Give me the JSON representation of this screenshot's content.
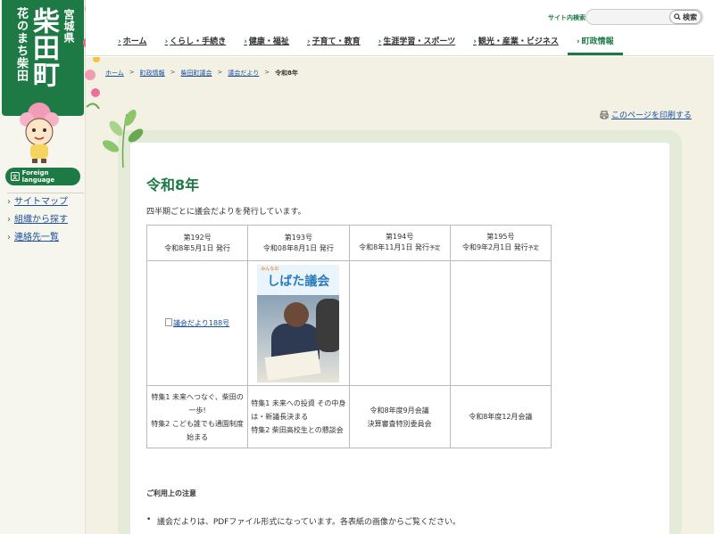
{
  "logo": {
    "sub": "花のまち柴田",
    "big": "柴田町",
    "pref": "宮城県"
  },
  "sidebar": {
    "foreign_label": "Foreign language",
    "links": [
      "サイトマップ",
      "組織から探す",
      "連絡先一覧"
    ]
  },
  "header": {
    "search_label": "サイト内検索",
    "search_placeholder": "",
    "search_button": "検索",
    "nav": [
      "ホーム",
      "くらし・手続き",
      "健康・福祉",
      "子育て・教育",
      "生涯学習・スポーツ",
      "観光・産業・ビジネス",
      "町政情報"
    ],
    "active_nav": "町政情報"
  },
  "breadcrumb": {
    "links": [
      "ホーム",
      "町政情報",
      "柴田町議会",
      "議会だより"
    ],
    "current": "令和8年"
  },
  "print_label": "このページを印刷する",
  "page": {
    "title": "令和8年",
    "intro": "四半期ごとに議会だよりを発行しています。",
    "issues": [
      {
        "number": "第192号",
        "date": "令和8年5月1日 発行",
        "pending": "",
        "image_alt": "議会だより188号",
        "desc": [
          "特集1 未来へつなぐ、柴田の一歩!",
          "特集2 こども誰でも通園制度 始まる"
        ]
      },
      {
        "number": "第193号",
        "date": "令和08年8月1日 発行",
        "pending": "",
        "image_alt": "",
        "desc": [
          "特集1 未来への投資 その中身は・新議長決まる",
          "特集2 柴田高校生との懇談会"
        ]
      },
      {
        "number": "第194号",
        "date": "令和8年11月1日 発行",
        "pending": "予定",
        "image_alt": "",
        "desc": [
          "令和8年度9月会議",
          "決算審査特別委員会"
        ]
      },
      {
        "number": "第195号",
        "date": "令和9年2月1日 発行",
        "pending": "予定",
        "image_alt": "",
        "desc": [
          "令和8年度12月会議"
        ]
      }
    ],
    "cover": {
      "small": "みんなの",
      "title": "しばた議会"
    },
    "notice_heading": "ご利用上の注意",
    "notice_item": "議会だよりは、PDFファイル形式になっています。各表紙の画像からご覧ください。"
  },
  "colors": {
    "brand_green": "#1e7a45",
    "link_blue": "#1a4f9c",
    "page_bg": "#f3f1e4",
    "frame_green": "#e4ecd9"
  },
  "icons": [
    "search-icon",
    "globe-icon",
    "print-icon",
    "chevron-right-icon"
  ]
}
